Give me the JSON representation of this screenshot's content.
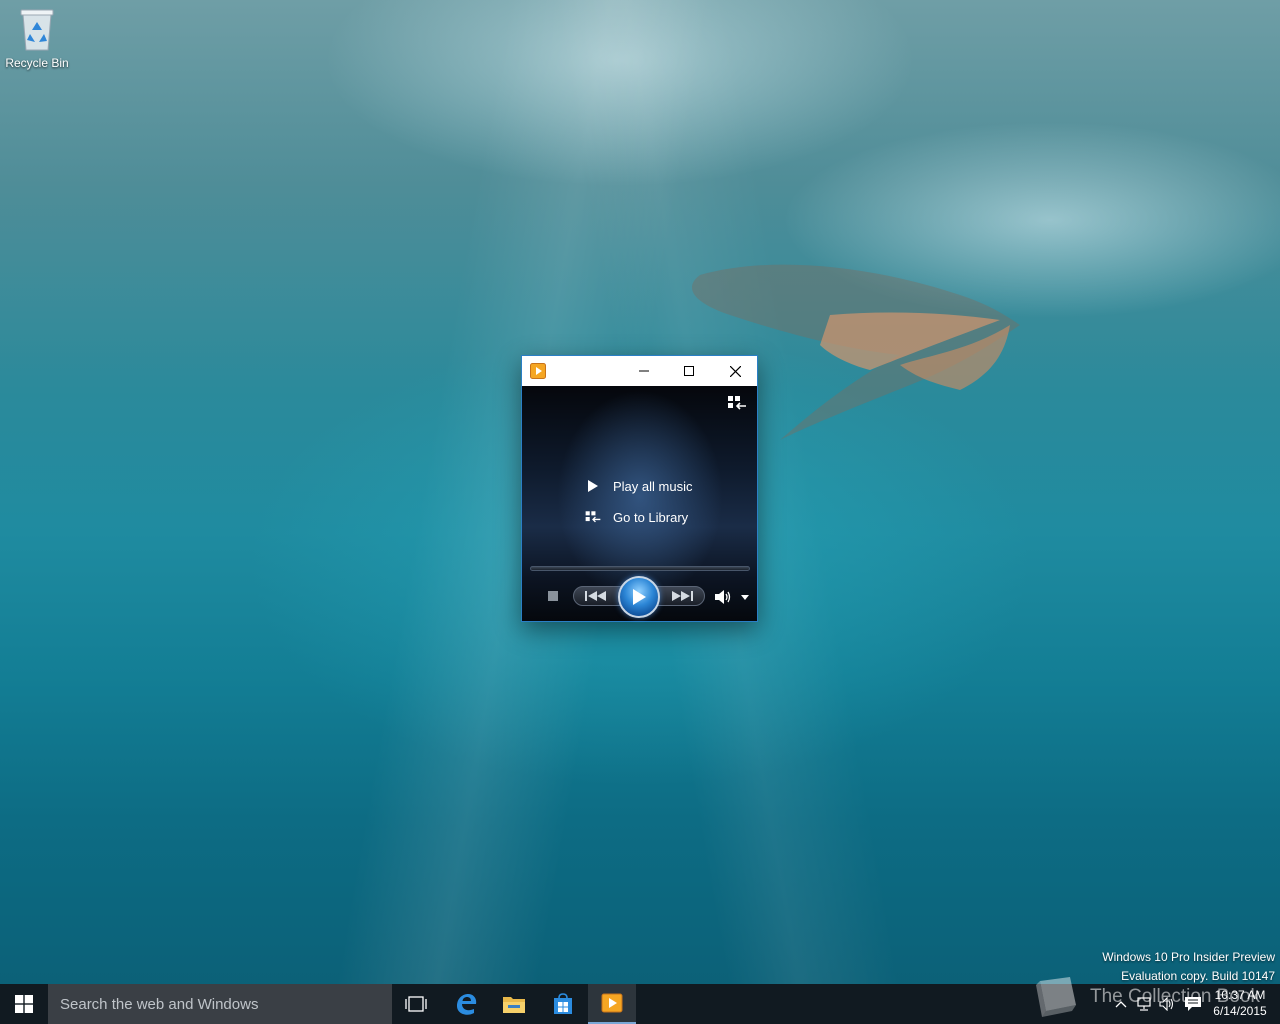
{
  "desktop": {
    "icons": [
      {
        "label": "Recycle Bin",
        "icon": "recycle-bin-icon"
      }
    ],
    "watermark": {
      "line1": "Windows 10 Pro Insider Preview",
      "line2": "Evaluation copy. Build 10147"
    }
  },
  "window": {
    "app_icon": "media-player-icon",
    "controls": {
      "minimize": "minimize-icon",
      "maximize": "maximize-icon",
      "close": "close-icon"
    },
    "switch_to_library_icon": "switch-to-library-icon",
    "links": [
      {
        "label": "Play all music",
        "icon": "play-icon"
      },
      {
        "label": "Go to Library",
        "icon": "library-icon"
      }
    ],
    "playback": {
      "stop": "stop-icon",
      "previous": "previous-icon",
      "play": "play-icon",
      "next": "next-icon",
      "volume": "volume-icon",
      "volume_menu": "chevron-down-icon"
    }
  },
  "taskbar": {
    "search_placeholder": "Search the web and Windows",
    "pinned": [
      "task-view-icon",
      "edge-icon",
      "file-explorer-icon",
      "store-icon",
      "media-player-icon"
    ],
    "tray_icons": [
      "chevron-up-icon",
      "network-icon",
      "speaker-icon",
      "action-center-icon"
    ],
    "time": "10:37 AM",
    "date": "6/14/2015",
    "overlay_watermark": "The Collection Book"
  },
  "colors": {
    "accent": "#2a7fc6",
    "taskbar": "#12181e",
    "search_box": "#3a3f45"
  }
}
